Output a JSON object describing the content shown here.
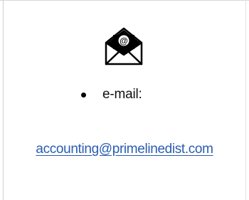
{
  "contact": {
    "icon": "email-envelope-icon",
    "label": "e-mail:",
    "email": "accounting@primelinedist.com",
    "link_color": "#2a5db0"
  }
}
